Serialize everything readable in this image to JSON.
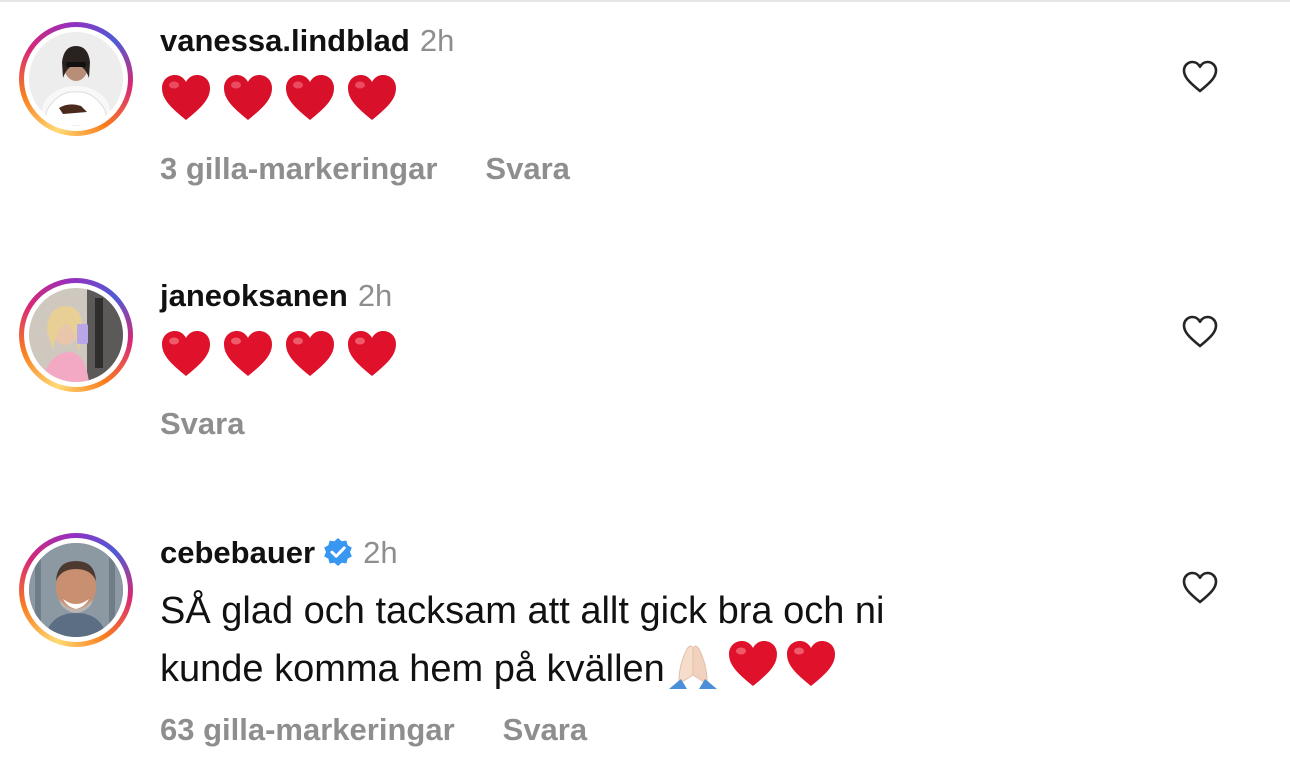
{
  "comments": [
    {
      "username": "vanessa.lindblad",
      "time": "2h",
      "verified": false,
      "content_type": "hearts",
      "heart_count": 4,
      "likes_label": "3 gilla-markeringar",
      "reply_label": "Svara"
    },
    {
      "username": "janeoksanen",
      "time": "2h",
      "verified": false,
      "content_type": "hearts",
      "heart_count": 4,
      "likes_label": "",
      "reply_label": "Svara"
    },
    {
      "username": "cebebauer",
      "time": "2h",
      "verified": true,
      "content_type": "text",
      "text_line1": "SÅ glad och tacksam att allt gick bra och ni",
      "text_line2": "kunde komma hem på kvällen",
      "likes_label": "63 gilla-markeringar",
      "reply_label": "Svara"
    }
  ],
  "icons": {
    "like": "heart-outline-icon",
    "verified": "verified-badge-icon",
    "emoji_heart": "red-heart-emoji",
    "emoji_pray": "folded-hands-emoji"
  },
  "colors": {
    "secondary_text": "#8e8e8e",
    "verified_blue": "#3897f0",
    "heart_red": "#e0112b"
  }
}
